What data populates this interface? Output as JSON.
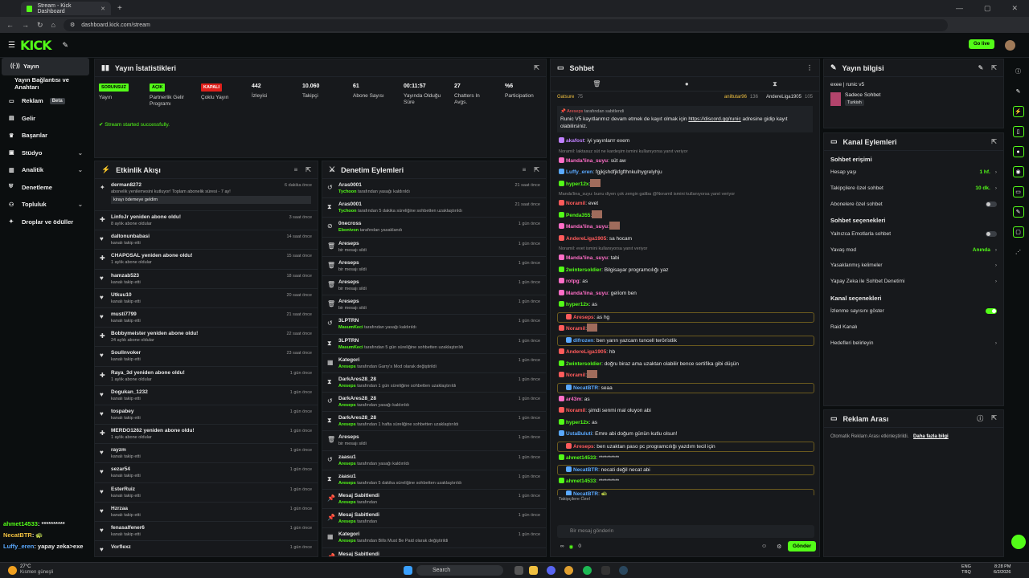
{
  "browser": {
    "tab_title": "Stream - Kick Dashboard",
    "url": "dashboard.kick.com/stream"
  },
  "header": {
    "logo": "KICK",
    "go_live": "Go live"
  },
  "sidebar": {
    "items": [
      {
        "label": "Yayın",
        "icon": "broadcast-icon",
        "active": true
      },
      {
        "label": "Yayın Bağlantısı ve Anahtarı",
        "icon": "",
        "indent": true
      },
      {
        "label": "Reklam",
        "icon": "ad-icon",
        "beta": "Beta"
      },
      {
        "label": "Gelir",
        "icon": "wallet-icon"
      },
      {
        "label": "Başarılar",
        "icon": "trophy-icon"
      },
      {
        "label": "Stüdyo",
        "icon": "studio-icon",
        "chev": true
      },
      {
        "label": "Analitik",
        "icon": "chart-icon",
        "chev": true
      },
      {
        "label": "Denetleme",
        "icon": "shield-icon"
      },
      {
        "label": "Topluluk",
        "icon": "users-icon",
        "chev": true
      },
      {
        "label": "Droplar ve ödüller",
        "icon": "gift-icon"
      }
    ],
    "mini_chat": [
      {
        "user": "ahmet14533",
        "text": ": **********",
        "color": "#53fc18"
      },
      {
        "user": "NecatBTR",
        "text": ": 🐢",
        "color": "#f0c040"
      },
      {
        "user": "Luffy_eren",
        "text": ": yapay zeka>exe",
        "color": "#5aa9ff"
      }
    ]
  },
  "stats": {
    "title": "Yayın İstatistikleri",
    "items": [
      {
        "badge": "SORUNSUZ",
        "badge_color": "#53fc18",
        "label": "Yayın"
      },
      {
        "badge": "AÇIK",
        "badge_color": "#53fc18",
        "label": "Partnerlik Gelir\nProgramı"
      },
      {
        "badge": "KAPALI",
        "badge_color": "#e0201b",
        "label": "Çoklu Yayın"
      },
      {
        "value": "442",
        "label": "İzleyici"
      },
      {
        "value": "10.060",
        "label": "Takipçi"
      },
      {
        "value": "61",
        "label": "Abone Sayısı"
      },
      {
        "value": "00:11:57",
        "label": "Yayında Olduğu\nSüre"
      },
      {
        "value": "27",
        "label": "Chatters In\nAvgs."
      },
      {
        "value": "%6",
        "label": "Participation"
      }
    ],
    "success": "Stream started successfully."
  },
  "activity": {
    "title": "Etkinlik Akışı",
    "rows": [
      {
        "icon": "gift-icon",
        "title": "derman8272",
        "sub": "abonelik yenilemesini kutluyor! Toplam abonelik süresi - 7 ay!",
        "time": "6 dakika önce",
        "note": "kirayı ödemeye geldim"
      },
      {
        "icon": "star-icon",
        "title": "LinfoJr yeniden abone oldu!",
        "sub": "8 aylık abone oldular",
        "time": "3 saat önce"
      },
      {
        "icon": "heart-icon",
        "title": "daltonunbabasi",
        "sub": "kanalı takip etti",
        "time": "14 saat önce"
      },
      {
        "icon": "star-icon",
        "title": "CHAPOSAL yeniden abone oldu!",
        "sub": "1 aylık abone oldular",
        "time": "15 saat önce"
      },
      {
        "icon": "heart-icon",
        "title": "hamzab523",
        "sub": "kanalı takip etti",
        "time": "18 saat önce"
      },
      {
        "icon": "heart-icon",
        "title": "Utkuu10",
        "sub": "kanalı takip etti",
        "time": "20 saat önce"
      },
      {
        "icon": "heart-icon",
        "title": "musti7799",
        "sub": "kanalı takip etti",
        "time": "21 saat önce"
      },
      {
        "icon": "star-icon",
        "title": "Bobbymeister yeniden abone oldu!",
        "sub": "24 aylık abone oldular",
        "time": "22 saat önce"
      },
      {
        "icon": "heart-icon",
        "title": "SoulInvoker",
        "sub": "kanalı takip etti",
        "time": "23 saat önce"
      },
      {
        "icon": "star-icon",
        "title": "Raya_3d yeniden abone oldu!",
        "sub": "1 aylık abone oldular",
        "time": "1 gün önce"
      },
      {
        "icon": "heart-icon",
        "title": "Dogukan_1232",
        "sub": "kanalı takip etti",
        "time": "1 gün önce"
      },
      {
        "icon": "heart-icon",
        "title": "tospabey",
        "sub": "kanalı takip etti",
        "time": "1 gün önce"
      },
      {
        "icon": "star-icon",
        "title": "MERDO1262 yeniden abone oldu!",
        "sub": "1 aylık abone oldular",
        "time": "1 gün önce"
      },
      {
        "icon": "heart-icon",
        "title": "rayzm",
        "sub": "kanalı takip etti",
        "time": "1 gün önce"
      },
      {
        "icon": "heart-icon",
        "title": "sezar54",
        "sub": "kanalı takip etti",
        "time": "1 gün önce"
      },
      {
        "icon": "heart-icon",
        "title": "EsterRuiz",
        "sub": "kanalı takip etti",
        "time": "1 gün önce"
      },
      {
        "icon": "heart-icon",
        "title": "Hzrzaa",
        "sub": "kanalı takip etti",
        "time": "1 gün önce"
      },
      {
        "icon": "heart-icon",
        "title": "fenasalfener6",
        "sub": "kanalı takip etti",
        "time": "1 gün önce"
      },
      {
        "icon": "heart-icon",
        "title": "Vorflexz",
        "sub": "",
        "time": "1 gün önce"
      }
    ]
  },
  "moderation": {
    "title": "Denetim Eylemleri",
    "rows": [
      {
        "icon": "undo-icon",
        "title": "Aras0001",
        "who": "Tychoon",
        "sub": " tarafından yasağı kaldırıldı",
        "time": "21 saat önce"
      },
      {
        "icon": "hourglass-icon",
        "title": "Aras0001",
        "who": "Tychoon",
        "sub": " tarafından 5 dakika süreliğine sohbetten uzaklaştırıldı",
        "time": "21 saat önce"
      },
      {
        "icon": "ban-icon",
        "title": "0necross",
        "who": "Ebonivon",
        "sub": " tarafından yasaklandı",
        "time": "1 gün önce"
      },
      {
        "icon": "trash-icon",
        "title": "Areseps",
        "who": "",
        "sub": "bir mesajı sildi",
        "time": "1 gün önce"
      },
      {
        "icon": "trash-icon",
        "title": "Areseps",
        "who": "",
        "sub": "bir mesajı sildi",
        "time": "1 gün önce"
      },
      {
        "icon": "trash-icon",
        "title": "Areseps",
        "who": "",
        "sub": "bir mesajı sildi",
        "time": "1 gün önce"
      },
      {
        "icon": "trash-icon",
        "title": "Areseps",
        "who": "",
        "sub": "bir mesajı sildi",
        "time": "1 gün önce"
      },
      {
        "icon": "undo-icon",
        "title": "3LPTRN",
        "who": "MasumKeci",
        "sub": " tarafından yasağı kaldırıldı",
        "time": "1 gün önce"
      },
      {
        "icon": "hourglass-icon",
        "title": "3LPTRN",
        "who": "MasumKeci",
        "sub": " tarafından 5 gün süreliğine sohbetten uzaklaştırıldı",
        "time": "1 gün önce"
      },
      {
        "icon": "category-icon",
        "title": "Kategori",
        "who": "Areseps",
        "sub": " tarafından Garry's Mod olarak değiştirildi",
        "time": "1 gün önce"
      },
      {
        "icon": "hourglass-icon",
        "title": "DarkAres28_28",
        "who": "Areseps",
        "sub": " tarafından 1 gün süreliğine sohbetten uzaklaştırıldı",
        "time": "1 gün önce"
      },
      {
        "icon": "undo-icon",
        "title": "DarkAres28_28",
        "who": "Areseps",
        "sub": " tarafından yasağı kaldırıldı",
        "time": "1 gün önce"
      },
      {
        "icon": "hourglass-icon",
        "title": "DarkAres28_28",
        "who": "Areseps",
        "sub": " tarafından 1 hafta süreliğine sohbetten uzaklaştırıldı",
        "time": "1 gün önce"
      },
      {
        "icon": "trash-icon",
        "title": "Areseps",
        "who": "",
        "sub": "bir mesajı sildi",
        "time": "1 gün önce"
      },
      {
        "icon": "undo-icon",
        "title": "zaasu1",
        "who": "Areseps",
        "sub": " tarafından yasağı kaldırıldı",
        "time": "1 gün önce"
      },
      {
        "icon": "hourglass-icon",
        "title": "zaasu1",
        "who": "Areseps",
        "sub": " tarafından 5 dakika süreliğine sohbetten uzaklaştırıldı",
        "time": "1 gün önce"
      },
      {
        "icon": "pin-icon",
        "title": "Mesaj Sabitlendi",
        "who": "Areseps",
        "sub": " tarafından",
        "time": "1 gün önce"
      },
      {
        "icon": "pin-icon",
        "title": "Mesaj Sabitlendi",
        "who": "Areseps",
        "sub": " tarafından",
        "time": "1 gün önce"
      },
      {
        "icon": "category-icon",
        "title": "Kategori",
        "who": "Areseps",
        "sub": " tarafından Bills Must Be Paid olarak değiştirildi",
        "time": "1 gün önce"
      },
      {
        "icon": "pin-icon",
        "title": "Mesaj Sabitlendi",
        "who": "",
        "sub": "",
        "time": ""
      }
    ]
  },
  "chat": {
    "title": "Sohbet",
    "top_user": "Gatsure",
    "top_count": "75",
    "lb": [
      {
        "user": "aniltutar96",
        "count": "136"
      },
      {
        "user": "AndereLiga1905",
        "count": "105"
      }
    ],
    "pinned_by": "tarafından sabitlendi",
    "pinned_text": "Runic V5 kayıtlarımız devam etmek de kayıt olmak için ",
    "pinned_link": "https://discord.gg/runic",
    "pinned_tail": " adresine gidip kayıt olabilirsiniz.",
    "lines": [
      {
        "u": "akafost",
        "c": "#c080ff",
        "t": ": iyi yayınlarrr exem"
      },
      {
        "sys": "Noramil: laktasuz süt ne kardeşim ismini kullanıyorsa yanıt veriyor"
      },
      {
        "u": "Manda'lina_suyu",
        "c": "#ff6ec7",
        "t": ": süt aw"
      },
      {
        "u": "Luffy_eren",
        "c": "#5aa9ff",
        "t": ": fgjkjshdfjkfgfthnkulhygrelyhju"
      },
      {
        "u": "hyper12x",
        "c": "#53fc18",
        "t": ":",
        "emote": true
      },
      {
        "sys": "Manda'lina_suyu: bunu diyen çok zengin galiba @Noramil ismini kullanıyorsa yanıt veriyor"
      },
      {
        "u": "Noramil",
        "c": "#ff5b5b",
        "t": ": evet"
      },
      {
        "u": "Penda355",
        "c": "#53fc18",
        "t": ":",
        "emote": true
      },
      {
        "u": "Manda'lina_suyu",
        "c": "#ff6ec7",
        "t": ":",
        "emote": true
      },
      {
        "u": "AndereLiga1905",
        "c": "#ff5b5b",
        "t": ": sa hocam"
      },
      {
        "sys": "Noramil: evet ismini kullanıyorsa yanıt veriyor"
      },
      {
        "u": "Manda'lina_suyu",
        "c": "#ff6ec7",
        "t": ": tabi"
      },
      {
        "u": "2wintersoldier",
        "c": "#53fc18",
        "t": ": Bilgisayar programcılığı yaz"
      },
      {
        "u": "rotpg",
        "c": "#ff6ec7",
        "t": ": as"
      },
      {
        "u": "Manda'lina_suyu",
        "c": "#ff6ec7",
        "t": ": gelíom ben"
      },
      {
        "u": "hyper12x",
        "c": "#53fc18",
        "t": ": as"
      },
      {
        "u": "Areseps",
        "c": "#ff5b5b",
        "t": ": as hg",
        "hl": true
      },
      {
        "u": "Noramil",
        "c": "#ff5b5b",
        "t": ":",
        "emote": true
      },
      {
        "u": "difrozen",
        "c": "#5aa9ff",
        "t": ": ben yarın yazcam tuncell terörístlik",
        "hl": true
      },
      {
        "u": "AndereLiga1905",
        "c": "#ff5b5b",
        "t": ": hb"
      },
      {
        "u": "2wintersoldier",
        "c": "#53fc18",
        "t": ": doğru biraz ama uzaktan olabilir bence sertifika gibi düşün"
      },
      {
        "u": "Noramil",
        "c": "#ff5b5b",
        "t": ":",
        "emote": true
      },
      {
        "u": "NecatBTR",
        "c": "#5aa9ff",
        "t": ": seaa",
        "hl": true
      },
      {
        "u": "ar43m",
        "c": "#ff6ec7",
        "t": ": as"
      },
      {
        "u": "Noramil",
        "c": "#ff5b5b",
        "t": ": şimdi senmi mal oluyon abi"
      },
      {
        "u": "hyper12x",
        "c": "#53fc18",
        "t": ": as"
      },
      {
        "u": "UstaBuluti",
        "c": "#5aa9ff",
        "t": ": Emre abi doğum günün kutlu olsun!"
      },
      {
        "u": "Areseps",
        "c": "#ff5b5b",
        "t": ": ben uzaktan paso pc programcılığı yazdım tecil için",
        "hl": true
      },
      {
        "u": "ahmet14533",
        "c": "#53fc18",
        "t": ": **********"
      },
      {
        "u": "NecatBTR",
        "c": "#5aa9ff",
        "t": ": necati değil necat abi",
        "hl": true
      },
      {
        "u": "ahmet14533",
        "c": "#53fc18",
        "t": ": **********"
      },
      {
        "u": "NecatBTR",
        "c": "#5aa9ff",
        "t": ": 🐢",
        "hl": true
      },
      {
        "u": "Luffy_eren",
        "c": "#5aa9ff",
        "t": ": yapay zeka>exe"
      }
    ],
    "followers_label": "Takipçilere Özel",
    "input_placeholder": "Bir mesaj gönderin",
    "views": "0",
    "send": "Gönder"
  },
  "info": {
    "title": "Yayın bilgisi",
    "stream_title": "exee | runic v5",
    "chat_mode": "Sadece Sohbet",
    "tag": "Turkish"
  },
  "actions": {
    "title": "Kanal Eylemleri",
    "sec1": "Sohbet erişimi",
    "r1": [
      {
        "label": "Hesap yaşı",
        "val": "1 hf."
      },
      {
        "label": "Takipçilere özel sohbet",
        "val": "10 dk."
      },
      {
        "label": "Abonelere özel sohbet",
        "toggle": false
      }
    ],
    "sec2": "Sohbet seçenekleri",
    "r2": [
      {
        "label": "Yalnızca Emotlarla sohbet",
        "toggle": false
      },
      {
        "label": "Yavaş mod",
        "val": "Anında"
      },
      {
        "label": "Yasaklanmış kelimeler",
        "val": ""
      },
      {
        "label": "Yapay Zeka ile Sohbet Denetimi",
        "val": ""
      }
    ],
    "sec3": "Kanal seçenekleri",
    "r3": [
      {
        "label": "İzlenme sayısını göster",
        "toggle": true
      },
      {
        "label": "Raid Kanalı"
      },
      {
        "label": "Hedefleri belirleyin",
        "val": ""
      }
    ]
  },
  "ads": {
    "title": "Reklam Arası",
    "text": "Otomatik Reklam Arası etkinleştirildi.",
    "link": "Daha fazla bilgi"
  },
  "taskbar": {
    "weather_temp": "27°C",
    "weather_text": "Kısmen güneşli",
    "search": "Search",
    "lang": "ENG",
    "lang2": "TRQ",
    "time": "8:28 PM",
    "date": "6/2/2026"
  }
}
